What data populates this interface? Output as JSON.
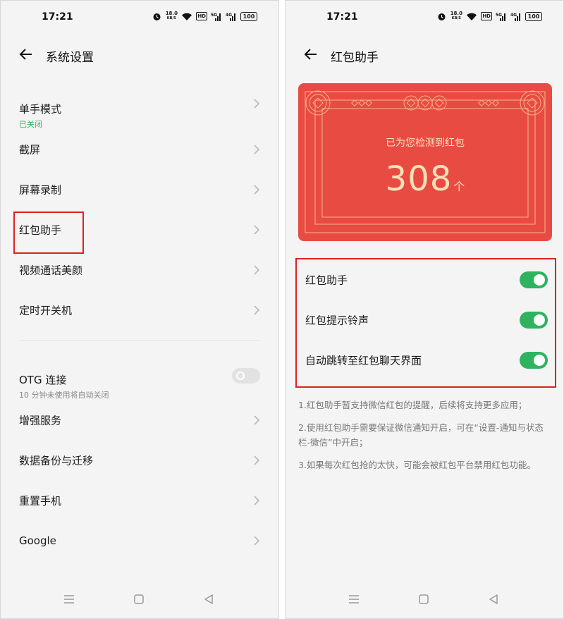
{
  "status": {
    "time": "17:21",
    "speed_value": "18.0",
    "speed_unit": "KB/S",
    "hd": "HD",
    "battery": "100",
    "sig1": "5G",
    "sig2": "4G"
  },
  "left": {
    "title": "系统设置",
    "items": [
      {
        "label": "单手模式",
        "sub": "已关闭"
      },
      {
        "label": "截屏"
      },
      {
        "label": "屏幕录制"
      },
      {
        "label": "红包助手"
      },
      {
        "label": "视频通话美颜"
      },
      {
        "label": "定时开关机"
      },
      {
        "label": "OTG 连接",
        "sub": "10 分钟未使用将自动关闭"
      },
      {
        "label": "增强服务"
      },
      {
        "label": "数据备份与迁移"
      },
      {
        "label": "重置手机"
      },
      {
        "label": "Google"
      }
    ]
  },
  "right": {
    "title": "红包助手",
    "card": {
      "caption": "已为您检测到红包",
      "count": "308",
      "unit": "个"
    },
    "toggles": [
      {
        "label": "红包助手",
        "on": true
      },
      {
        "label": "红包提示铃声",
        "on": true
      },
      {
        "label": "自动跳转至红包聊天界面",
        "on": true
      }
    ],
    "notes": [
      "1.红包助手暂支持微信红包的提醒，后续将支持更多应用；",
      "2.使用红包助手需要保证微信通知开启，可在“设置-通知与状态栏-微信”中开启；",
      "3.如果每次红包抢的太快，可能会被红包平台禁用红包功能。"
    ]
  },
  "colors": {
    "accent_green": "#2fb35f",
    "card_red": "#e84b42",
    "gold": "#fbe0b8",
    "highlight_red": "#e02020"
  }
}
